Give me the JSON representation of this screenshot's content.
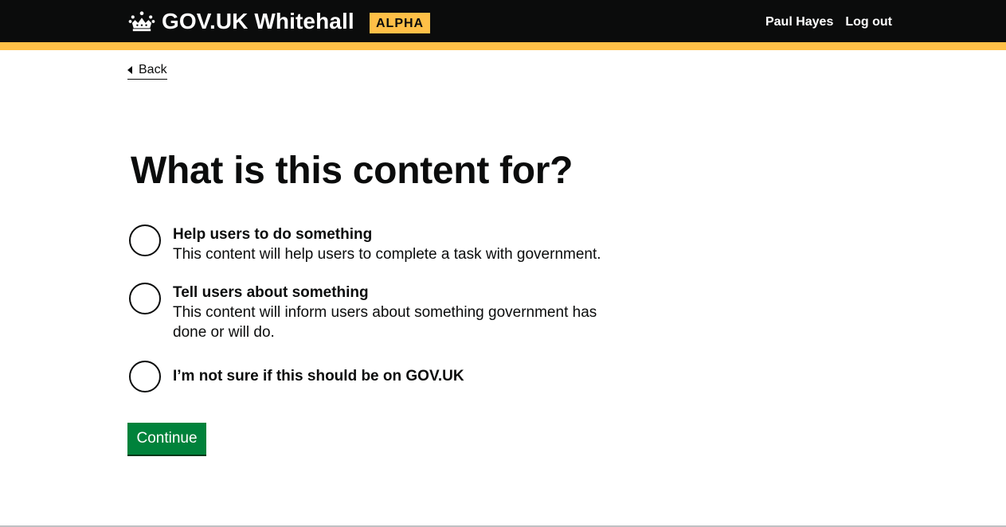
{
  "header": {
    "service_name": "GOV.UK Whitehall",
    "phase_tag": "ALPHA",
    "user_name": "Paul Hayes",
    "logout_label": "Log out"
  },
  "back_link": {
    "label": "Back"
  },
  "page_title": "What is this content for?",
  "options": [
    {
      "label": "Help users to do something",
      "hint": "This content will help users to complete a task with government."
    },
    {
      "label": "Tell users about something",
      "hint": "This content will inform users about something government has done or will do."
    },
    {
      "label": "I’m not sure if this should be on GOV.UK",
      "hint": ""
    }
  ],
  "continue_button": {
    "label": "Continue"
  },
  "colors": {
    "header_bg": "#0b0c0c",
    "accent_stripe": "#ffbf47",
    "button_green": "#00823b"
  },
  "icons": {
    "logo": "crown-icon",
    "back": "back-arrow-icon"
  }
}
